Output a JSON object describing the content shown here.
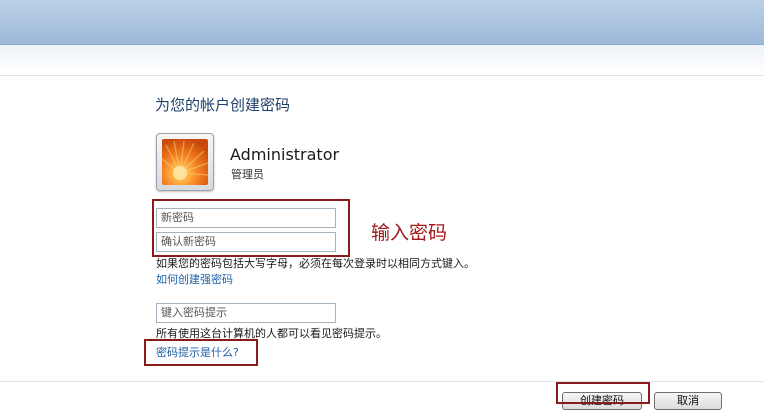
{
  "dialog": {
    "heading": "为您的帐户创建密码"
  },
  "user": {
    "name": "Administrator",
    "role": "管理员"
  },
  "form": {
    "new_password_placeholder": "新密码",
    "confirm_password_placeholder": "确认新密码",
    "caps_note": "如果您的密码包括大写字母，必须在每次登录时以相同方式键入。",
    "strong_password_link": "如何创建强密码",
    "hint_placeholder": "键入密码提示",
    "hint_note": "所有使用这台计算机的人都可以看见密码提示。",
    "hint_help_link": "密码提示是什么?"
  },
  "annotation": {
    "text": "输入密码"
  },
  "buttons": {
    "create": "创建密码",
    "cancel": "取消"
  },
  "colors": {
    "accent_annotation": "#a01818",
    "link": "#1f5fa8",
    "heading": "#1f3f6b"
  }
}
